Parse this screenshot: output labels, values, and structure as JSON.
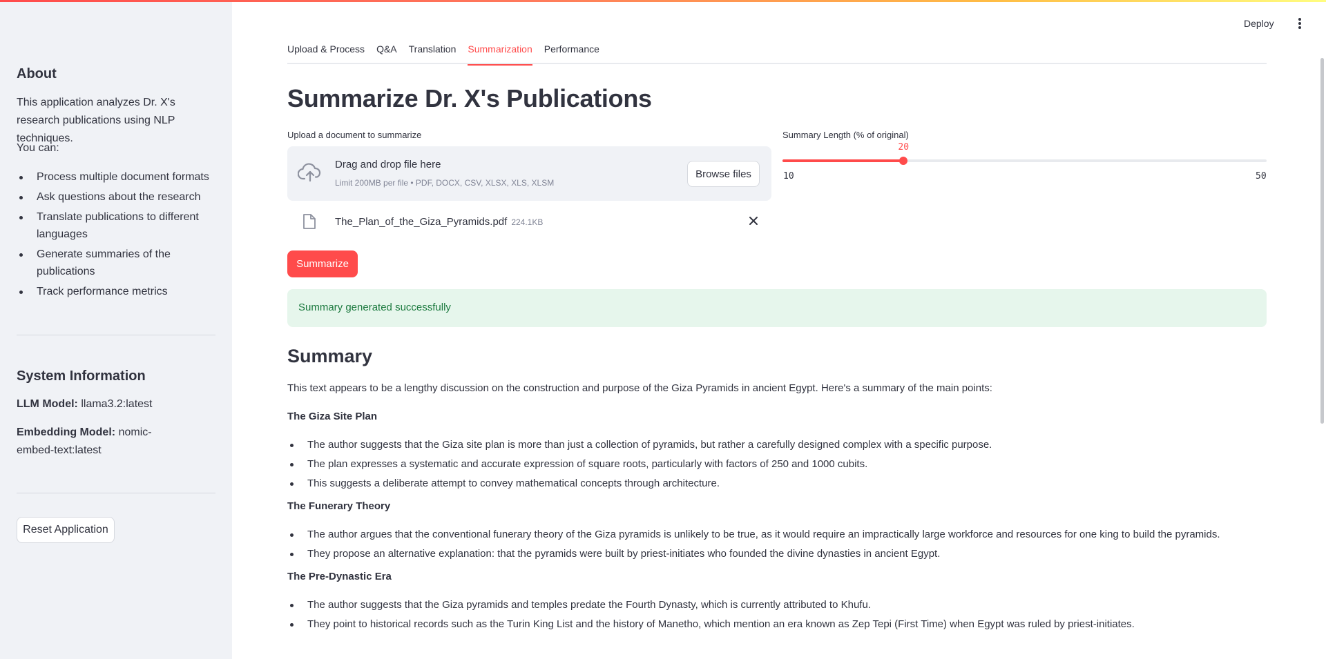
{
  "sidebar": {
    "about_title": "About",
    "about_text": "This application analyzes Dr. X's research publications using NLP techniques.",
    "you_can": "You can:",
    "features": [
      "Process multiple document formats",
      "Ask questions about the research",
      "Translate publications to different languages",
      "Generate summaries of the publications",
      "Track performance metrics"
    ],
    "system_title": "System Information",
    "llm_label": "LLM Model:",
    "llm_value": "llama3.2:latest",
    "embed_label": "Embedding Model:",
    "embed_value": "nomic-embed-text:latest",
    "reset_label": "Reset Application"
  },
  "header": {
    "deploy_label": "Deploy",
    "menu_icon": "kebab-menu-icon"
  },
  "tabs": [
    {
      "label": "Upload & Process",
      "active": false
    },
    {
      "label": "Q&A",
      "active": false
    },
    {
      "label": "Translation",
      "active": false
    },
    {
      "label": "Summarization",
      "active": true
    },
    {
      "label": "Performance",
      "active": false
    }
  ],
  "main": {
    "title": "Summarize Dr. X's Publications",
    "uploader": {
      "label": "Upload a document to summarize",
      "drop_title": "Drag and drop file here",
      "drop_sub": "Limit 200MB per file • PDF, DOCX, CSV, XLSX, XLS, XLSM",
      "browse_label": "Browse files",
      "cloud_icon": "cloud-upload-icon",
      "file": {
        "name": "The_Plan_of_the_Giza_Pyramids.pdf",
        "size": "224.1KB",
        "icon": "file-icon"
      }
    },
    "slider": {
      "label": "Summary Length (% of original)",
      "min": 10,
      "max": 50,
      "value": 20
    },
    "summarize_label": "Summarize",
    "success_message": "Summary generated successfully",
    "summary": {
      "heading": "Summary",
      "intro": "This text appears to be a lengthy discussion on the construction and purpose of the Giza Pyramids in ancient Egypt. Here's a summary of the main points:",
      "sections": [
        {
          "title": "The Giza Site Plan",
          "points": [
            "The author suggests that the Giza site plan is more than just a collection of pyramids, but rather a carefully designed complex with a specific purpose.",
            "The plan expresses a systematic and accurate expression of square roots, particularly with factors of 250 and 1000 cubits.",
            "This suggests a deliberate attempt to convey mathematical concepts through architecture."
          ]
        },
        {
          "title": "The Funerary Theory",
          "points": [
            "The author argues that the conventional funerary theory of the Giza pyramids is unlikely to be true, as it would require an impractically large workforce and resources for one king to build the pyramids.",
            "They propose an alternative explanation: that the pyramids were built by priest-initiates who founded the divine dynasties in ancient Egypt."
          ]
        },
        {
          "title": "The Pre-Dynastic Era",
          "points": [
            "The author suggests that the Giza pyramids and temples predate the Fourth Dynasty, which is currently attributed to Khufu.",
            "They point to historical records such as the Turin King List and the history of Manetho, which mention an era known as Zep Tepi (First Time) when Egypt was ruled by priest-initiates."
          ]
        }
      ]
    }
  },
  "colors": {
    "accent": "#ff4b4b",
    "sidebar_bg": "#f0f2f6",
    "success_bg": "#e6f6ec",
    "success_text": "#1c7a3f"
  }
}
